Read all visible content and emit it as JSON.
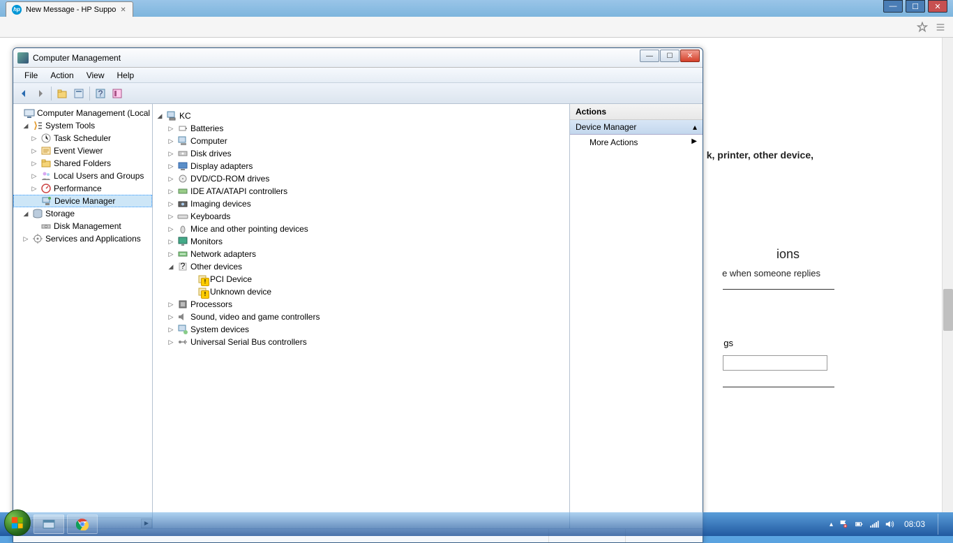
{
  "browser": {
    "tab_title": "New Message - HP Suppo",
    "window_controls": {
      "min": "—",
      "max": "☐",
      "close": "✕"
    },
    "toolbar_icons": {
      "star": "star-icon",
      "menu": "menu-icon"
    }
  },
  "webpage_behind": {
    "line1_frag": "k, printer, other device,",
    "heading_frag": "ions",
    "subline_frag": "e when someone replies",
    "tags_frag": "gs"
  },
  "mmc": {
    "title": "Computer Management",
    "menu": [
      "File",
      "Action",
      "View",
      "Help"
    ],
    "left_tree": {
      "root": {
        "label": "Computer Management (Local"
      },
      "system_tools": {
        "label": "System Tools",
        "children": [
          {
            "label": "Task Scheduler"
          },
          {
            "label": "Event Viewer"
          },
          {
            "label": "Shared Folders"
          },
          {
            "label": "Local Users and Groups"
          },
          {
            "label": "Performance"
          },
          {
            "label": "Device Manager",
            "selected": true
          }
        ]
      },
      "storage": {
        "label": "Storage",
        "children": [
          {
            "label": "Disk Management"
          }
        ]
      },
      "services": {
        "label": "Services and Applications"
      }
    },
    "center_tree": {
      "root": "KC",
      "items": [
        {
          "label": "Batteries"
        },
        {
          "label": "Computer"
        },
        {
          "label": "Disk drives"
        },
        {
          "label": "Display adapters"
        },
        {
          "label": "DVD/CD-ROM drives"
        },
        {
          "label": "IDE ATA/ATAPI controllers"
        },
        {
          "label": "Imaging devices"
        },
        {
          "label": "Keyboards"
        },
        {
          "label": "Mice and other pointing devices"
        },
        {
          "label": "Monitors"
        },
        {
          "label": "Network adapters"
        },
        {
          "label": "Other devices",
          "expanded": true,
          "children": [
            {
              "label": "PCI Device",
              "warn": true
            },
            {
              "label": "Unknown device",
              "warn": true
            }
          ]
        },
        {
          "label": "Processors"
        },
        {
          "label": "Sound, video and game controllers"
        },
        {
          "label": "System devices"
        },
        {
          "label": "Universal Serial Bus controllers"
        }
      ]
    },
    "actions": {
      "header": "Actions",
      "sub": "Device Manager",
      "more": "More Actions"
    }
  },
  "taskbar": {
    "clock": "08:03"
  }
}
